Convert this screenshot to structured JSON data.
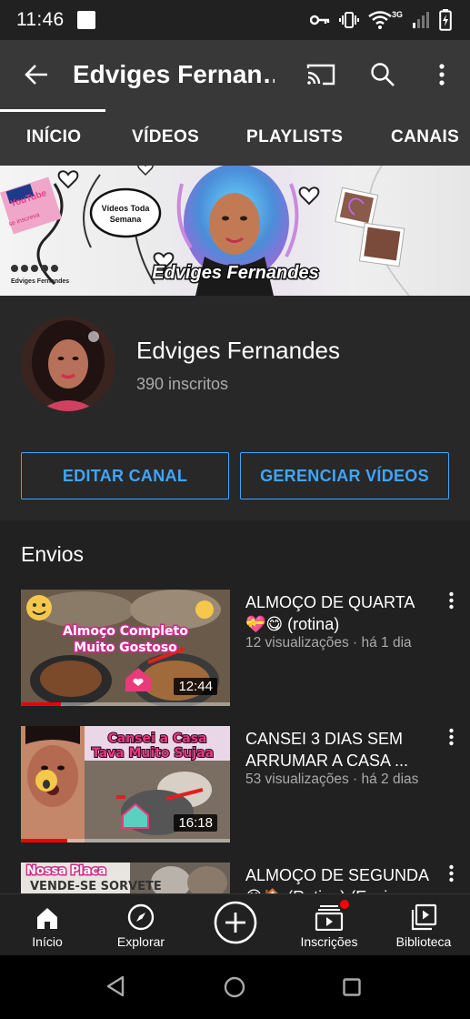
{
  "status_bar": {
    "time": "11:46",
    "network": "3G",
    "icons": [
      "notification-square-icon",
      "key-icon",
      "vibrate-icon",
      "wifi-icon",
      "signal-icon",
      "battery-charging-icon"
    ]
  },
  "app_bar": {
    "title": "Edviges Fernan…",
    "icons": [
      "back-arrow-icon",
      "cast-icon",
      "search-icon",
      "more-vert-icon"
    ]
  },
  "tabs": [
    {
      "label": "INÍCIO",
      "active": true
    },
    {
      "label": "VÍDEOS",
      "active": false
    },
    {
      "label": "PLAYLISTS",
      "active": false
    },
    {
      "label": "CANAIS",
      "active": false
    }
  ],
  "banner": {
    "bubble_text": "Vídeos Toda Semana",
    "name_text": "Edviges Fernandes",
    "small_text": "Edviges Fernandes",
    "youtube_text": "YouTube"
  },
  "channel": {
    "name": "Edviges Fernandes",
    "subscribers": "390 inscritos",
    "edit_button": "EDITAR CANAL",
    "manage_button": "GERENCIAR VÍDEOS"
  },
  "uploads": {
    "section_title": "Envios",
    "videos": [
      {
        "title": "ALMOÇO DE QUARTA 💝😋 (rotina)",
        "meta": "12 visualizações · há 1 dia",
        "duration": "12:44",
        "watched_fraction": 0.19,
        "thumb_text": [
          "Almoço Completo",
          "Muito Gostoso"
        ]
      },
      {
        "title": "CANSEI 3 DIAS SEM ARRUMAR A CASA ...",
        "meta": "53 visualizações · há 2 dias",
        "duration": "16:18",
        "watched_fraction": 0.22,
        "thumb_text": [
          "Cansei a Casa",
          "Tava Muito Sujaa"
        ]
      },
      {
        "title": "ALMOÇO DE SEGUNDA 😋🏠 (Rotina) (Ensin",
        "meta": "",
        "duration": "",
        "watched_fraction": 0,
        "thumb_text": [
          "Nossa Placa",
          "VENDE-SE SORVETE"
        ]
      }
    ]
  },
  "bottom_nav": [
    {
      "label": "Início",
      "icon": "home-icon",
      "active": true
    },
    {
      "label": "Explorar",
      "icon": "compass-icon",
      "active": false
    },
    {
      "label": "",
      "icon": "add-circle-icon",
      "active": false
    },
    {
      "label": "Inscrições",
      "icon": "subscriptions-icon",
      "active": false,
      "badge": true
    },
    {
      "label": "Biblioteca",
      "icon": "library-icon",
      "active": false
    }
  ],
  "colors": {
    "accent_blue": "#3ea6ff",
    "progress_red": "#ee0000",
    "app_bar": "#383838",
    "background": "#212121"
  }
}
